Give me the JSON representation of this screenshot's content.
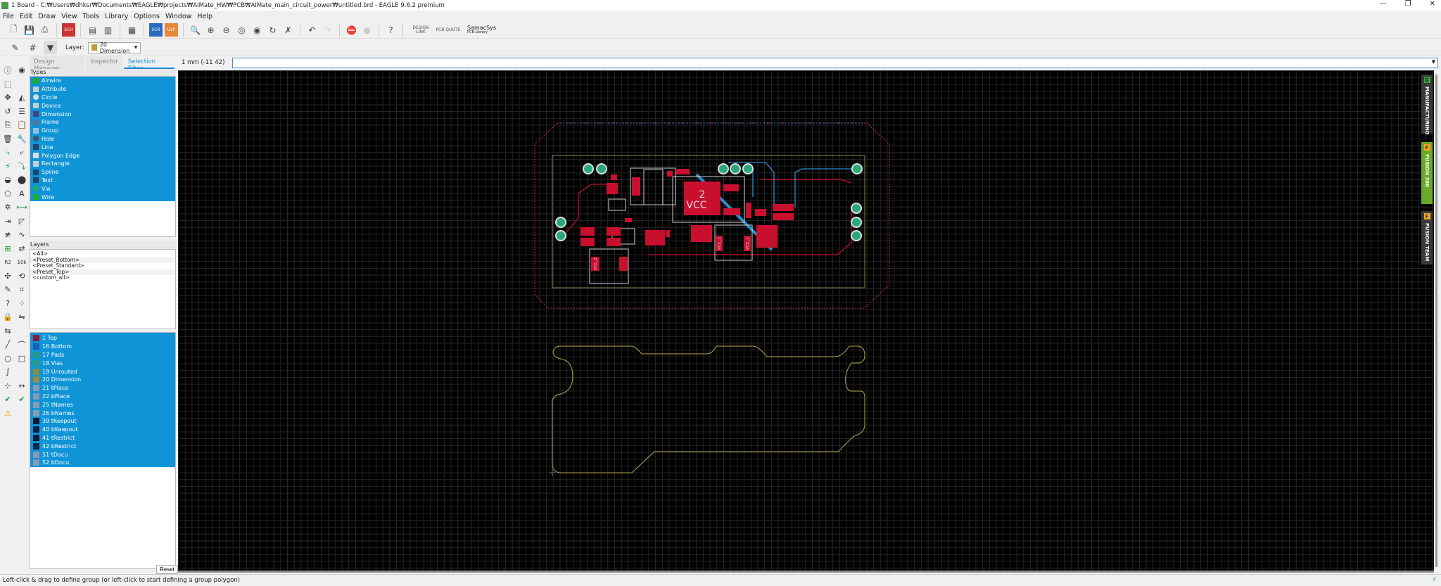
{
  "window": {
    "title": "1 Board - C:₩Users₩dhksr₩Documents₩EAGLE₩projects₩AIMate_HW₩PCB₩AIMate_main_circuit_power₩untitled.brd - EAGLE 9.6.2 premium",
    "controls": [
      "—",
      "❐",
      "✕"
    ]
  },
  "menu": [
    "File",
    "Edit",
    "Draw",
    "View",
    "Tools",
    "Library",
    "Options",
    "Window",
    "Help"
  ],
  "toolbar": {
    "icons": [
      {
        "name": "new-icon",
        "g": "🗋"
      },
      {
        "name": "save-icon",
        "g": "💾"
      },
      {
        "name": "print-icon",
        "g": "⎙"
      },
      {
        "sep": true
      },
      {
        "name": "schematic-icon",
        "g": "SCH"
      },
      {
        "sep": true
      },
      {
        "name": "cam-icon",
        "g": "▤"
      },
      {
        "name": "cam-export-icon",
        "g": "▥"
      },
      {
        "sep": true
      },
      {
        "name": "library-icon",
        "g": "▦"
      },
      {
        "sep": true
      },
      {
        "name": "script-icon",
        "g": "SCR"
      },
      {
        "name": "ulp-icon",
        "g": "ULP"
      },
      {
        "sep": true
      },
      {
        "name": "zoom-fit-icon",
        "g": "🔍"
      },
      {
        "name": "zoom-in-icon",
        "g": "⊕"
      },
      {
        "name": "zoom-out-icon",
        "g": "⊖"
      },
      {
        "name": "zoom-select-icon",
        "g": "◎"
      },
      {
        "name": "zoom-last-icon",
        "g": "◉"
      },
      {
        "name": "redraw-icon",
        "g": "↻"
      },
      {
        "name": "ratsnest-icon",
        "g": "✗"
      },
      {
        "sep": true
      },
      {
        "name": "undo-icon",
        "g": "↶"
      },
      {
        "name": "redo-icon",
        "g": "↷"
      },
      {
        "sep": true
      },
      {
        "name": "stop-icon",
        "g": "⛔"
      },
      {
        "name": "go-icon",
        "g": "●"
      },
      {
        "sep": true
      },
      {
        "name": "help-icon",
        "g": "?"
      },
      {
        "sep": true
      }
    ],
    "design_link": "DESIGN LINK",
    "pcb_quote": "PCB QUOTE",
    "samacsys": "SamacSys",
    "samacsys_sub": "PCB Library"
  },
  "layerbar": {
    "label": "Layer:",
    "selected": "20 Dimension",
    "swatch": "#c0a030"
  },
  "tabs": [
    {
      "label": "Design Manager",
      "active": false
    },
    {
      "label": "Inspector",
      "active": false
    },
    {
      "label": "Selection Filter",
      "active": true
    }
  ],
  "coordinate": "1 mm (-11 42)",
  "command": {
    "value": ""
  },
  "lefttools": [
    "info-icon",
    "eye-icon",
    "select-icon",
    "",
    "move-icon",
    "mirror-icon",
    "rotate-icon",
    "align-icon",
    "copy-icon",
    "paste-icon",
    "delete-icon",
    "wrench-icon",
    "route-icon",
    "ripup-icon",
    "autoroute-icon",
    "optimize-icon",
    "via-icon",
    "hole-icon",
    "polygon-icon",
    "text-icon",
    "split-icon",
    "meander-icon",
    "miter-icon",
    "slice-icon",
    "layer-dist-icon",
    "meander-wave-icon",
    "add-part-icon",
    "replace-icon",
    "name-icon",
    "value-icon",
    "smash-icon",
    "change-icon",
    "paint-icon",
    "tag-icon",
    "question-icon",
    "group-icon",
    "lock-icon",
    "pinswap-icon",
    "gateswap-icon",
    "",
    "line-icon",
    "arc-icon",
    "circle-icon",
    "rectangle-icon",
    "spline-icon",
    "",
    "mark-icon",
    "dimension-icon",
    "erc-icon",
    "drc-icon",
    "warning-icon",
    ""
  ],
  "types": {
    "header": "Types",
    "items": [
      {
        "label": "Airwire",
        "icon": "airwire-icon",
        "c": "#2a2"
      },
      {
        "label": "Attribute",
        "icon": "tag-icon",
        "c": "#ccc"
      },
      {
        "label": "Circle",
        "icon": "circle-icon",
        "c": "#ddd"
      },
      {
        "label": "Device",
        "icon": "device-icon",
        "c": "#ccc"
      },
      {
        "label": "Dimension",
        "icon": "dimension-icon",
        "c": "#447"
      },
      {
        "label": "Frame",
        "icon": "frame-icon",
        "c": "#579"
      },
      {
        "label": "Group",
        "icon": "group-icon",
        "c": "#9bd"
      },
      {
        "label": "Hole",
        "icon": "hole-icon",
        "c": "#456"
      },
      {
        "label": "Line",
        "icon": "line-icon",
        "c": "#246"
      },
      {
        "label": "Polygon Edge",
        "icon": "polygon-icon",
        "c": "#ddd"
      },
      {
        "label": "Rectangle",
        "icon": "rectangle-icon",
        "c": "#ccd"
      },
      {
        "label": "Spline",
        "icon": "spline-icon",
        "c": "#246"
      },
      {
        "label": "Text",
        "icon": "text-icon",
        "c": "#246"
      },
      {
        "label": "Via",
        "icon": "via-icon",
        "c": "#2a6"
      },
      {
        "label": "Wire",
        "icon": "wire-icon",
        "c": "#2a2"
      }
    ]
  },
  "layers": {
    "header": "Layers",
    "presets": [
      "<All>",
      "<Preset_Bottom>",
      "<Preset_Standard>",
      "<Preset_Top>",
      "<custom_all>"
    ],
    "items": [
      {
        "label": "1 Top",
        "c": "#8b1a3a"
      },
      {
        "label": "16 Bottom",
        "c": "#1560b0"
      },
      {
        "label": "17 Pads",
        "c": "#2a9a7a"
      },
      {
        "label": "18 Vias",
        "c": "#2a9a7a"
      },
      {
        "label": "19 Unrouted",
        "c": "#8a8a40"
      },
      {
        "label": "20 Dimension",
        "c": "#a08a40"
      },
      {
        "label": "21 tPlace",
        "c": "#8a9ab0"
      },
      {
        "label": "22 bPlace",
        "c": "#8a9ab0"
      },
      {
        "label": "25 tNames",
        "c": "#8a9ab0"
      },
      {
        "label": "26 bNames",
        "c": "#8a9ab0"
      },
      {
        "label": "39 tKeepout",
        "c": "#101830"
      },
      {
        "label": "40 bKeepout",
        "c": "#102040"
      },
      {
        "label": "41 tRestrict",
        "c": "#101838"
      },
      {
        "label": "42 bRestrict",
        "c": "#102848"
      },
      {
        "label": "51 tDocu",
        "c": "#8a9ab0"
      },
      {
        "label": "52 bDocu",
        "c": "#8a9ab0"
      }
    ],
    "reset": "Reset"
  },
  "sidetabs": [
    {
      "label": "MANUFACTURING",
      "badge": "◘",
      "bg": "#3a3a3a",
      "badge_c": "#3a3"
    },
    {
      "label": "FUSION 360",
      "badge": "F",
      "bg": "#6aaa2a",
      "badge_c": "#f5a623"
    },
    {
      "label": "FUSION TEAM",
      "badge": "F",
      "bg": "#3a3a3a",
      "badge_c": "#f5a623"
    }
  ],
  "board": {
    "label_vcc_big": "2\nVCC",
    "vcc_labels": [
      "VCC_2",
      "VCC_1",
      "VCC_1"
    ]
  },
  "colors": {
    "top": "#c8102e",
    "bottom": "#2a8fd0",
    "pad": "#2aa87a",
    "dimension": "#b8a850",
    "restrict": "#d03050"
  },
  "status": {
    "text": "Left-click & drag to define group (or left-click to start defining a group polygon)"
  }
}
